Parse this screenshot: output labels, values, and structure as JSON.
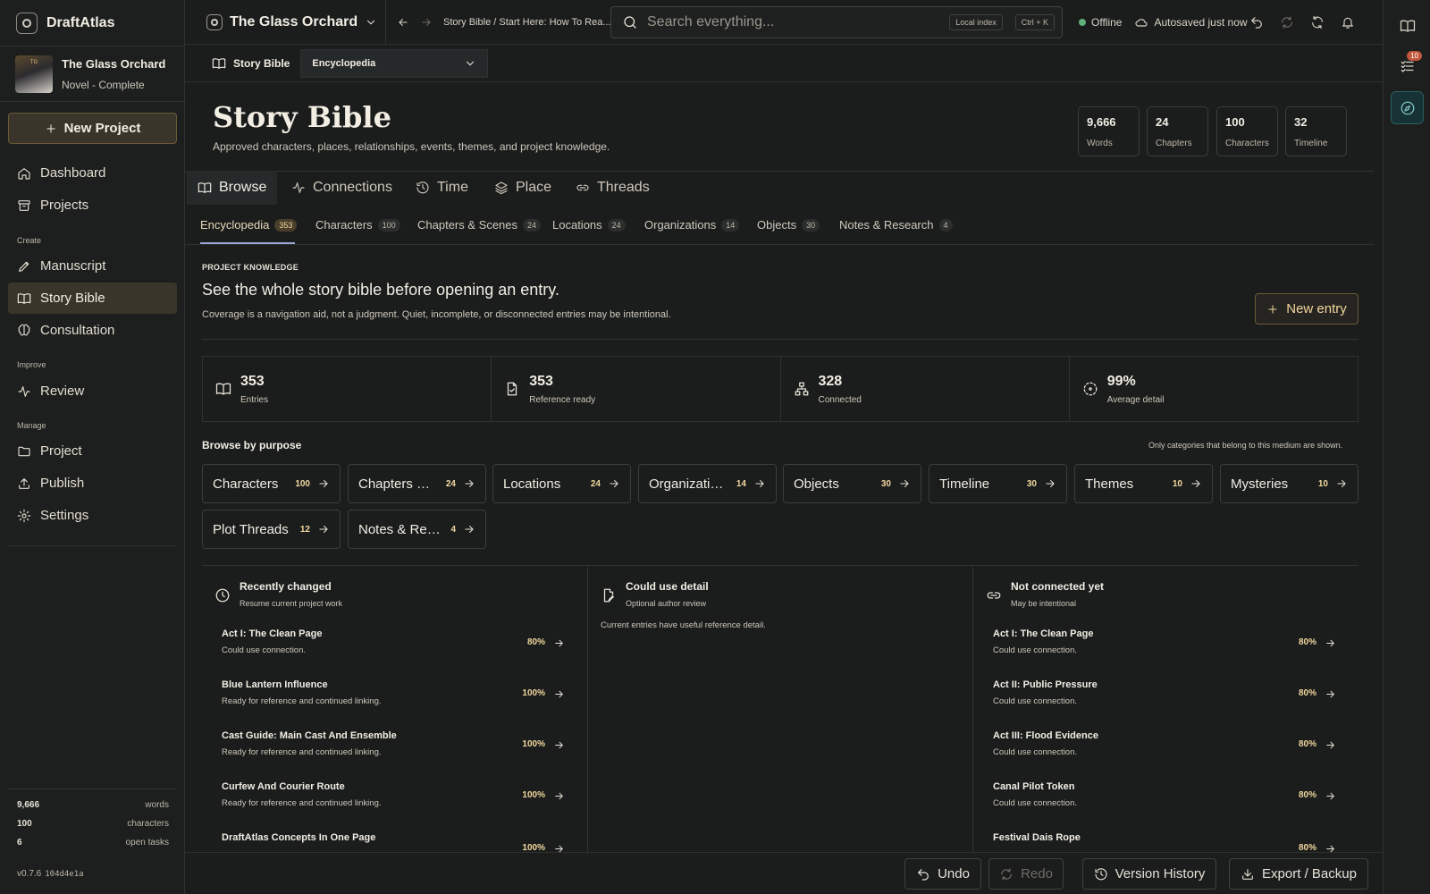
{
  "app": {
    "name": "DraftAtlas"
  },
  "project": {
    "title": "The Glass Orchard",
    "subtitle": "Novel - Complete",
    "cover_text": "TG"
  },
  "sidebar": {
    "new_project": "New Project",
    "nav": [
      {
        "label": "Dashboard",
        "icon": "home-icon"
      },
      {
        "label": "Projects",
        "icon": "archive-icon"
      },
      {
        "label": "Manuscript",
        "icon": "pen-icon"
      },
      {
        "label": "Story Bible",
        "icon": "book-icon",
        "active": true
      },
      {
        "label": "Consultation",
        "icon": "brain-icon"
      },
      {
        "label": "Review",
        "icon": "activity-icon"
      },
      {
        "label": "Project",
        "icon": "folder-icon"
      },
      {
        "label": "Publish",
        "icon": "upload-icon"
      },
      {
        "label": "Settings",
        "icon": "gear-icon"
      }
    ],
    "sections": {
      "create": "Create",
      "improve": "Improve",
      "manage": "Manage"
    },
    "stats": [
      {
        "value": "9,666",
        "label": "words"
      },
      {
        "value": "100",
        "label": "characters"
      },
      {
        "value": "6",
        "label": "open tasks"
      }
    ],
    "version": "v0.7.6",
    "build": "104d4e1a"
  },
  "topbar": {
    "project": "The Glass Orchard",
    "breadcrumb": "Story Bible / Start Here: How To Rea...",
    "search_placeholder": "Search everything...",
    "local_index": "Local index",
    "shortcut": "Ctrl + K",
    "offline": "Offline",
    "autosaved": "Autosaved just now"
  },
  "rail": {
    "tasks_badge": "10"
  },
  "subheader": {
    "title": "Story Bible",
    "select_value": "Encyclopedia"
  },
  "header": {
    "title": "Story Bible",
    "subtitle": "Approved characters, places, relationships, events, themes, and project knowledge.",
    "stats": [
      {
        "value": "9,666",
        "label": "Words"
      },
      {
        "value": "24",
        "label": "Chapters"
      },
      {
        "value": "100",
        "label": "Characters"
      },
      {
        "value": "32",
        "label": "Timeline"
      }
    ]
  },
  "mode_tabs": [
    {
      "label": "Browse",
      "icon": "book-icon"
    },
    {
      "label": "Connections",
      "icon": "activity-icon"
    },
    {
      "label": "Time",
      "icon": "clock-history-icon"
    },
    {
      "label": "Place",
      "icon": "layers-icon"
    },
    {
      "label": "Threads",
      "icon": "link-icon"
    }
  ],
  "category_tabs": [
    {
      "label": "Encyclopedia",
      "count": "353"
    },
    {
      "label": "Characters",
      "count": "100"
    },
    {
      "label": "Chapters & Scenes",
      "count": "24"
    },
    {
      "label": "Locations",
      "count": "24"
    },
    {
      "label": "Organizations",
      "count": "14"
    },
    {
      "label": "Objects",
      "count": "30"
    },
    {
      "label": "Notes & Research",
      "count": "4"
    }
  ],
  "knowledge": {
    "kicker": "PROJECT KNOWLEDGE",
    "title": "See the whole story bible before opening an entry.",
    "subtitle": "Coverage is a navigation aid, not a judgment. Quiet, incomplete, or disconnected entries may be intentional.",
    "new_entry": "New entry",
    "kpis": [
      {
        "value": "353",
        "label": "Entries",
        "icon": "book-icon"
      },
      {
        "value": "353",
        "label": "Reference ready",
        "icon": "file-check-icon"
      },
      {
        "value": "328",
        "label": "Connected",
        "icon": "network-icon"
      },
      {
        "value": "99%",
        "label": "Average detail",
        "icon": "dashed-circle-icon"
      }
    ]
  },
  "purpose": {
    "title": "Browse by purpose",
    "note": "Only categories that belong to this medium are shown.",
    "items": [
      {
        "label": "Characters",
        "count": "100"
      },
      {
        "label": "Chapters & Scenes",
        "count": "24"
      },
      {
        "label": "Locations",
        "count": "24"
      },
      {
        "label": "Organizations",
        "count": "14"
      },
      {
        "label": "Objects",
        "count": "30"
      },
      {
        "label": "Timeline",
        "count": "30"
      },
      {
        "label": "Themes",
        "count": "10"
      },
      {
        "label": "Mysteries",
        "count": "10"
      },
      {
        "label": "Plot Threads",
        "count": "12"
      },
      {
        "label": "Notes & Research",
        "count": "4"
      }
    ]
  },
  "panels": [
    {
      "title": "Recently changed",
      "subtitle": "Resume current project work",
      "icon": "clock-icon",
      "rows": [
        {
          "title": "Act I: The Clean Page",
          "desc": "Could use connection.",
          "pct": "80%"
        },
        {
          "title": "Blue Lantern Influence",
          "desc": "Ready for reference and continued linking.",
          "pct": "100%"
        },
        {
          "title": "Cast Guide: Main Cast And Ensemble",
          "desc": "Ready for reference and continued linking.",
          "pct": "100%"
        },
        {
          "title": "Curfew And Courier Route",
          "desc": "Ready for reference and continued linking.",
          "pct": "100%"
        },
        {
          "title": "DraftAtlas Concepts In One Page",
          "desc": "",
          "pct": "100%"
        }
      ]
    },
    {
      "title": "Could use detail",
      "subtitle": "Optional author review",
      "icon": "file-edit-icon",
      "empty": "Current entries have useful reference detail.",
      "rows": []
    },
    {
      "title": "Not connected yet",
      "subtitle": "May be intentional",
      "icon": "link-icon",
      "rows": [
        {
          "title": "Act I: The Clean Page",
          "desc": "Could use connection.",
          "pct": "80%"
        },
        {
          "title": "Act II: Public Pressure",
          "desc": "Could use connection.",
          "pct": "80%"
        },
        {
          "title": "Act III: Flood Evidence",
          "desc": "Could use connection.",
          "pct": "80%"
        },
        {
          "title": "Canal Pilot Token",
          "desc": "Could use connection.",
          "pct": "80%"
        },
        {
          "title": "Festival Dais Rope",
          "desc": "",
          "pct": "80%"
        }
      ]
    }
  ],
  "bottombar": {
    "undo": "Undo",
    "redo": "Redo",
    "history": "Version History",
    "export": "Export / Backup"
  },
  "colors": {
    "accent": "#f1d79e",
    "active_bg": "#3a352a",
    "rail_active": "#7fc3c2",
    "online_dot": "#5fb07a"
  }
}
